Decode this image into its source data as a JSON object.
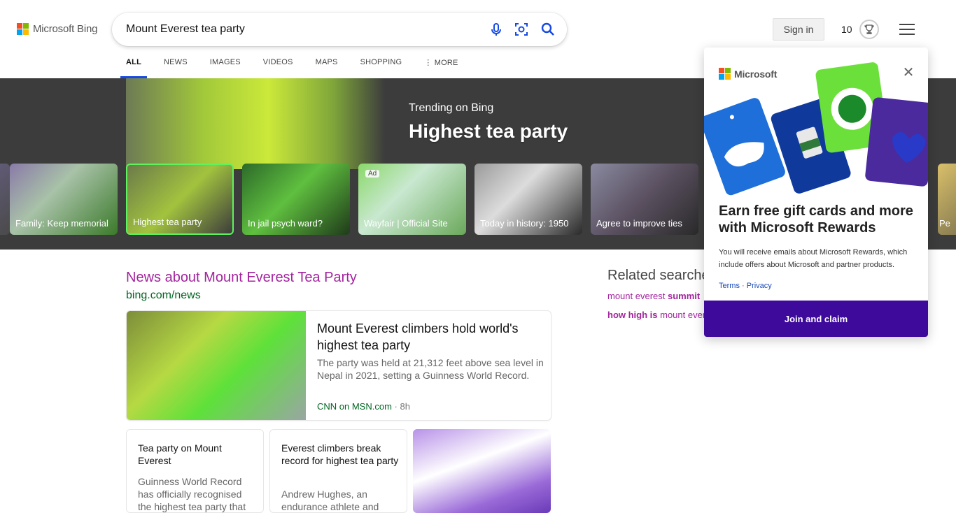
{
  "header": {
    "logo_text": "Microsoft Bing",
    "search_value": "Mount Everest tea party",
    "signin_label": "Sign in",
    "points": "10"
  },
  "tabs": [
    {
      "label": "ALL",
      "active": true
    },
    {
      "label": "NEWS"
    },
    {
      "label": "IMAGES"
    },
    {
      "label": "VIDEOS"
    },
    {
      "label": "MAPS"
    },
    {
      "label": "SHOPPING"
    },
    {
      "label": "MORE"
    }
  ],
  "trending": {
    "subtitle": "Trending on Bing",
    "title": "Highest tea party",
    "cards": [
      {
        "label": "Family: Keep memorial"
      },
      {
        "label": "Highest tea party",
        "selected": true
      },
      {
        "label": "In jail psych ward?"
      },
      {
        "label": "Wayfair | Official Site",
        "ad": "Ad"
      },
      {
        "label": "Today in history: 1950"
      },
      {
        "label": "Agree to improve ties"
      },
      {
        "label": "Pe"
      }
    ]
  },
  "news": {
    "heading": "News about Mount Everest Tea Party",
    "source_link": "bing.com/news",
    "main": {
      "title": "Mount Everest climbers hold world's highest tea party",
      "desc": "The party was held at 21,312 feet above sea level in Nepal in 2021, setting a Guinness World Record.",
      "source": "CNN on MSN.com",
      "age": "8h"
    },
    "small": [
      {
        "title": "Tea party on Mount Everest",
        "desc": "Guinness World Record has officially recognised the highest tea party that"
      },
      {
        "title": "Everest climbers break record for highest tea party",
        "desc": "Andrew Hughes, an endurance athlete and"
      }
    ]
  },
  "related": {
    "heading": "Related searches",
    "items": [
      {
        "plain": "mount everest ",
        "bold": "summit"
      },
      {
        "bold": "how high is",
        "plain": " mount everest"
      }
    ]
  },
  "popup": {
    "brand": "Microsoft",
    "heading": "Earn free gift cards and more with Microsoft Rewards",
    "body": "You will receive emails about Microsoft Rewards, which include offers about Microsoft and partner products.",
    "terms": "Terms",
    "privacy": "Privacy",
    "sep": " · ",
    "cta": "Join and claim",
    "close": "✕"
  }
}
